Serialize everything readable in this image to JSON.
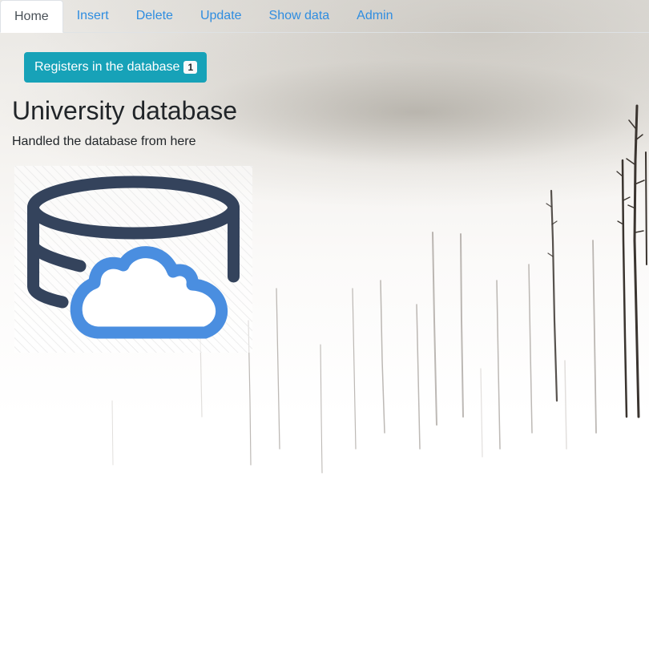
{
  "nav": {
    "tabs": [
      {
        "label": "Home",
        "active": true
      },
      {
        "label": "Insert"
      },
      {
        "label": "Delete"
      },
      {
        "label": "Update"
      },
      {
        "label": "Show data"
      },
      {
        "label": "Admin"
      }
    ]
  },
  "registers_button": {
    "label": "Registers in the database",
    "count": "1"
  },
  "header": {
    "title": "University database",
    "subtitle": "Handled the database from here"
  },
  "image": {
    "icon": "database-cloud-icon"
  },
  "colors": {
    "link": "#2f8de0",
    "button": "#17a2b8",
    "database_stroke": "#34435c",
    "cloud_stroke": "#4a8ee0"
  }
}
